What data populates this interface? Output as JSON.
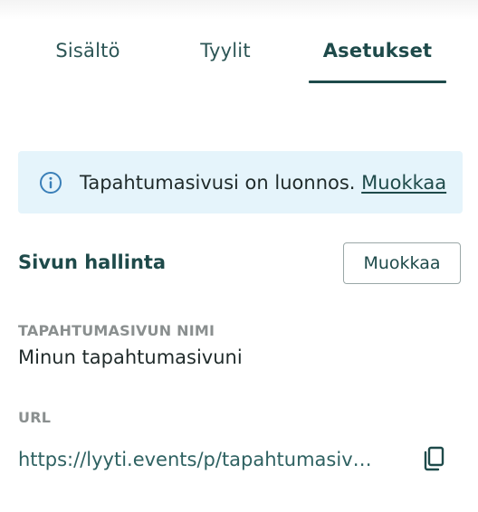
{
  "tabs": [
    {
      "label": "Sisältö",
      "active": false
    },
    {
      "label": "Tyylit",
      "active": false
    },
    {
      "label": "Asetukset",
      "active": true
    }
  ],
  "notice": {
    "icon": "info-icon",
    "text": "Tapahtumasivusi on luonnos.",
    "link_label": "Muokkaa"
  },
  "page_management": {
    "title": "Sivun hallinta",
    "edit_label": "Muokkaa",
    "name_label": "TAPAHTUMASIVUN NIMI",
    "name_value": "Minun tapahtumasivuni",
    "url_label": "URL",
    "url_value": "https://lyyti.events/p/tapahtumasivuni",
    "copy_icon": "copy-icon"
  },
  "colors": {
    "accent": "#1e4a4a",
    "notice_bg": "#e5f4fb",
    "info_icon": "#3a7fb8",
    "muted_label": "#8a8f8f"
  }
}
